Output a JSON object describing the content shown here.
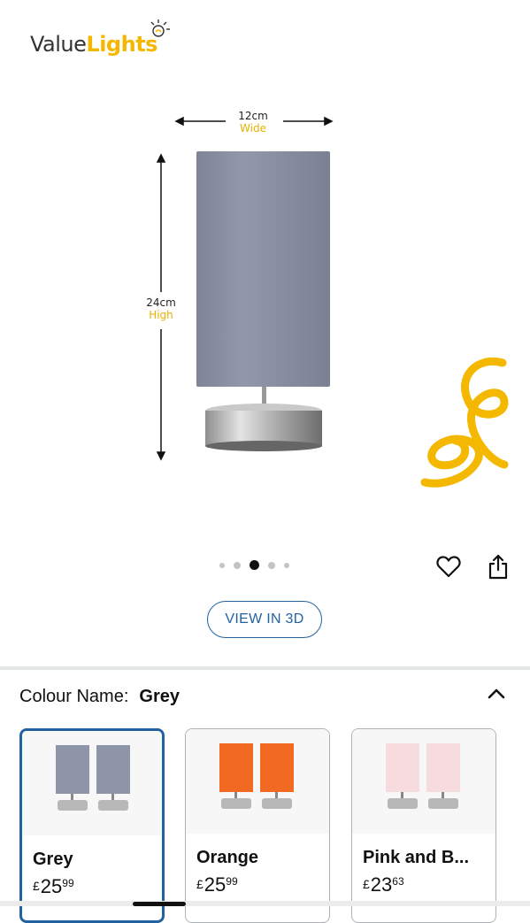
{
  "brand": {
    "logo_value": "Value",
    "logo_lights": "Lights"
  },
  "dimensions": {
    "width_num": "12cm",
    "width_unit": "Wide",
    "height_num": "24cm",
    "height_unit": "High"
  },
  "carousel": {
    "total": 5,
    "active_index": 2
  },
  "actions": {
    "favorite_icon": "heart-icon",
    "share_icon": "share-icon"
  },
  "view3d_label": "VIEW IN 3D",
  "colour": {
    "label": "Colour Name:",
    "value": "Grey"
  },
  "swatches": [
    {
      "name": "Grey",
      "currency": "£",
      "whole": "25",
      "fraction": "99",
      "shade_color": "#8e95a8"
    },
    {
      "name": "Orange",
      "currency": "£",
      "whole": "25",
      "fraction": "99",
      "shade_color": "#f26a21"
    },
    {
      "name": "Pink and B...",
      "currency": "£",
      "whole": "23",
      "fraction": "63",
      "shade_color": "#f6dcdf"
    }
  ],
  "colors": {
    "accent_blue": "#2162a1",
    "brand_yellow": "#f5b800"
  }
}
